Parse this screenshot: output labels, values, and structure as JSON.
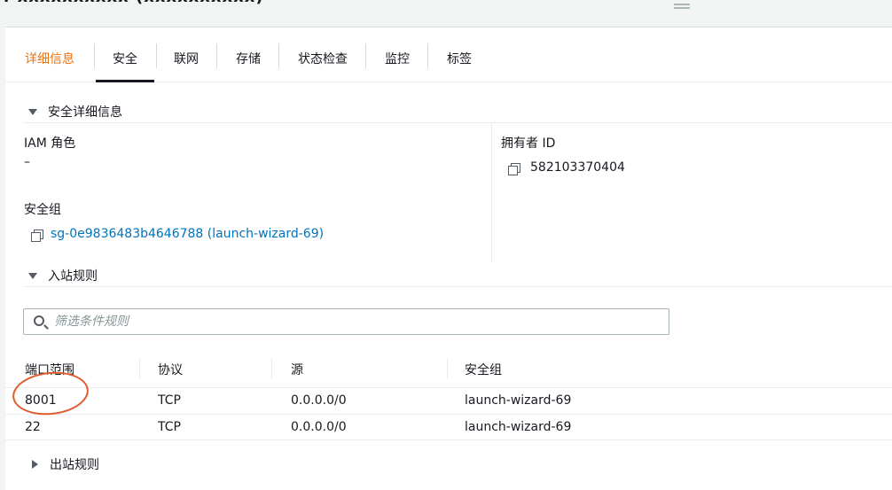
{
  "tabs": [
    {
      "label": "详细信息"
    },
    {
      "label": "安全"
    },
    {
      "label": "联网"
    },
    {
      "label": "存储"
    },
    {
      "label": "状态检查"
    },
    {
      "label": "监控"
    },
    {
      "label": "标签"
    }
  ],
  "security_details": {
    "heading": "安全详细信息",
    "iam_role_label": "IAM 角色",
    "iam_role_value": "–",
    "owner_id_label": "拥有者 ID",
    "owner_id_value": "582103370404",
    "security_groups_label": "安全组",
    "security_group_link": "sg-0e9836483b4646788 (launch-wizard-69)"
  },
  "inbound": {
    "heading": "入站规则",
    "filter_placeholder": "筛选条件规则",
    "columns": [
      "端口范围",
      "协议",
      "源",
      "安全组"
    ],
    "rows": [
      {
        "port": "8001",
        "protocol": "TCP",
        "source": "0.0.0.0/0",
        "security_group": "launch-wizard-69"
      },
      {
        "port": "22",
        "protocol": "TCP",
        "source": "0.0.0.0/0",
        "security_group": "launch-wizard-69"
      }
    ]
  },
  "outbound": {
    "heading": "出站规则"
  },
  "colors": {
    "active_tab": "#ec7211",
    "link": "#0073bb",
    "annotation": "#e05a2b"
  }
}
